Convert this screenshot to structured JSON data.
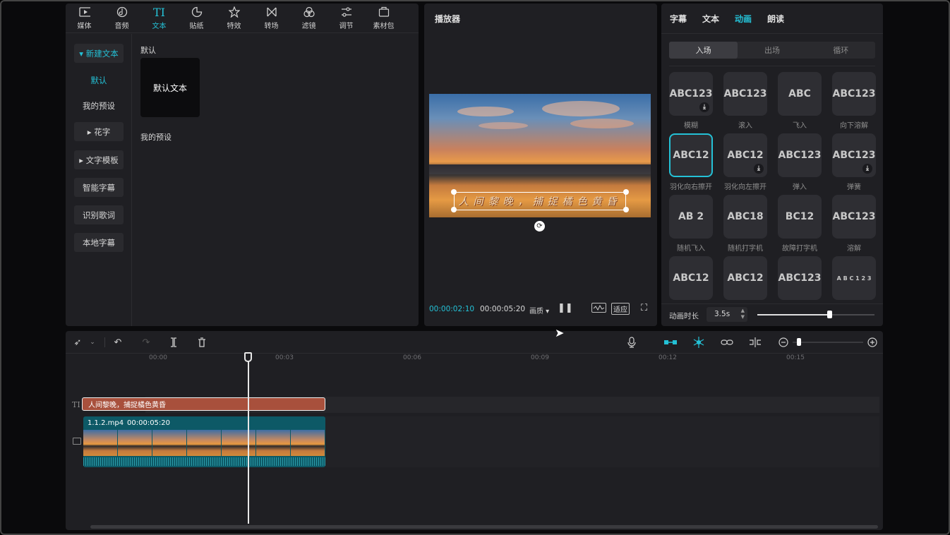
{
  "toolbar": [
    {
      "label": "媒体",
      "icon": "media-icon"
    },
    {
      "label": "音频",
      "icon": "audio-icon"
    },
    {
      "label": "文本",
      "icon": "text-icon",
      "active": true
    },
    {
      "label": "贴纸",
      "icon": "sticker-icon"
    },
    {
      "label": "特效",
      "icon": "effects-icon"
    },
    {
      "label": "转场",
      "icon": "transition-icon"
    },
    {
      "label": "滤镜",
      "icon": "filter-icon"
    },
    {
      "label": "调节",
      "icon": "adjust-icon"
    },
    {
      "label": "素材包",
      "icon": "package-icon"
    }
  ],
  "sidebar": {
    "new_text": "▾ 新建文本",
    "default": "默认",
    "my_presets": "我的预设",
    "fancy": "▸ 花字",
    "templates": "▸ 文字模板",
    "smart_captions": "智能字幕",
    "lyrics": "识别歌词",
    "local_captions": "本地字幕"
  },
  "content": {
    "section_default": "默认",
    "default_tile": "默认文本",
    "section_presets": "我的预设"
  },
  "player": {
    "title": "播放器",
    "subtitle": "人间黎晚，捕捉橘色黄昏",
    "current_time": "00:00:02:10",
    "total_time": "00:00:05:20",
    "quality": "画质",
    "fit": "适应"
  },
  "right_panel": {
    "tabs": [
      "字幕",
      "文本",
      "动画",
      "朗读"
    ],
    "active_tab": "动画",
    "segments": [
      "入场",
      "出场",
      "循环"
    ],
    "active_segment": "入场",
    "animations": [
      {
        "preview": "ABC123",
        "label": "模糊",
        "download": true
      },
      {
        "preview": "ABC123",
        "label": "滚入",
        "download": false
      },
      {
        "preview": "ABC",
        "label": "飞入",
        "download": false
      },
      {
        "preview": "ABC123",
        "label": "向下溶解",
        "download": false
      },
      {
        "preview": "ABC12",
        "label": "羽化向右擦开",
        "download": false,
        "selected": true
      },
      {
        "preview": "ABC12",
        "label": "羽化向左擦开",
        "download": true
      },
      {
        "preview": "ABC123",
        "label": "弹入",
        "download": false
      },
      {
        "preview": "ABC123",
        "label": "弹簧",
        "download": true
      },
      {
        "preview": "AB 2",
        "label": "随机飞入",
        "download": false
      },
      {
        "preview": "ABC18",
        "label": "随机打字机",
        "download": false
      },
      {
        "preview": "BC12",
        "label": "故障打字机",
        "download": false
      },
      {
        "preview": "ABC123",
        "label": "溶解",
        "download": false
      },
      {
        "preview": "ABC12",
        "label": "",
        "download": false
      },
      {
        "preview": "ABC12",
        "label": "",
        "download": false
      },
      {
        "preview": "ABC123",
        "label": "",
        "download": false
      },
      {
        "preview": "A B C 1 2 3",
        "label": "",
        "download": false
      }
    ],
    "duration_label": "动画时长",
    "duration_value": "3.5s"
  },
  "timeline": {
    "ticks": [
      "00:00",
      "00:03",
      "00:06",
      "00:09",
      "00:12",
      "00:15"
    ],
    "text_clip": "人间黎晚，捕捉橘色黄昏",
    "video_clip_name": "1.1.2.mp4",
    "video_clip_duration": "00:00:05:20",
    "cover": "封面"
  },
  "colors": {
    "accent": "#24c1d6",
    "panel": "#1f1f23",
    "text_clip": "#a8503c",
    "video_clip": "#0d5966"
  }
}
